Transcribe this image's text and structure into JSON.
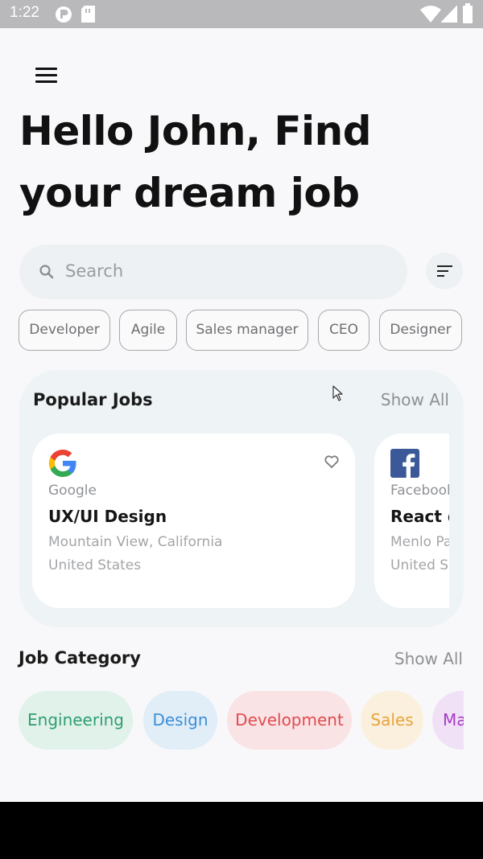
{
  "status_bar": {
    "time": "1:22",
    "icons": [
      "notification-icon",
      "sim-card-icon",
      "wifi-icon",
      "signal-icon",
      "battery-icon"
    ]
  },
  "header": {
    "menu_icon": "hamburger-menu-icon",
    "greeting": "Hello John, Find your dream job"
  },
  "search": {
    "placeholder": "Search",
    "icon": "search-icon",
    "filter_icon": "filter-icon"
  },
  "chips": [
    "Developer",
    "Agile",
    "Sales manager",
    "CEO",
    "Designer"
  ],
  "popular_jobs": {
    "title": "Popular Jobs",
    "show_all": "Show All",
    "jobs": [
      {
        "company": "Google",
        "role": "UX/UI Design",
        "location_line1": "Mountain View, California",
        "location_line2": "United States",
        "logo_icon": "google-logo-icon",
        "favorite_icon": "heart-outline-icon"
      },
      {
        "company": "Facebook",
        "role": "React d",
        "location_line1": "Menlo Pa",
        "location_line2": "United S",
        "logo_icon": "facebook-logo-icon"
      }
    ]
  },
  "job_category": {
    "title": "Job Category",
    "show_all": "Show All",
    "categories": [
      {
        "label": "Engineering",
        "color": "#2e9e72",
        "bg": "#e1f2ea"
      },
      {
        "label": "Design",
        "color": "#3b8fd9",
        "bg": "#e1eef8"
      },
      {
        "label": "Development",
        "color": "#e04b52",
        "bg": "#fae3e4"
      },
      {
        "label": "Sales",
        "color": "#e8a33c",
        "bg": "#fbf0dd"
      },
      {
        "label": "Ma",
        "color": "#a73bc5",
        "bg": "#f1e1f6"
      }
    ]
  },
  "colors": {
    "accent_google_blue": "#4285F4",
    "facebook_blue": "#3b5998",
    "status_bar": "#b9b8bb"
  }
}
